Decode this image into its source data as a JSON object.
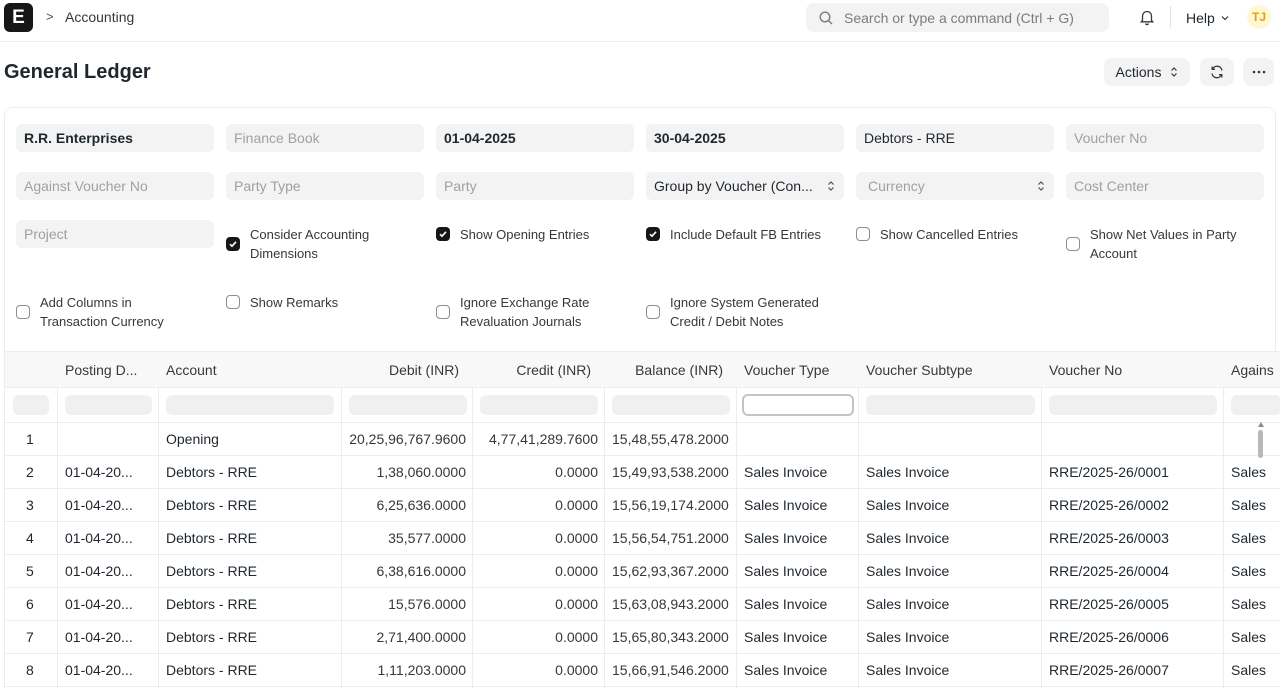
{
  "navbar": {
    "logo_letter": "E",
    "breadcrumb_sep": ">",
    "breadcrumb": "Accounting",
    "search_placeholder": "Search or type a command (Ctrl + G)",
    "help_label": "Help",
    "avatar_initials": "TJ"
  },
  "page": {
    "title": "General Ledger",
    "actions_label": "Actions"
  },
  "filters": {
    "company": "R.R. Enterprises",
    "finance_book_placeholder": "Finance Book",
    "from_date": "01-04-2025",
    "to_date": "30-04-2025",
    "account": "Debtors - RRE",
    "voucher_no_placeholder": "Voucher No",
    "against_voucher_no_placeholder": "Against Voucher No",
    "party_type_placeholder": "Party Type",
    "party_placeholder": "Party",
    "group_by": "Group by Voucher (Con...",
    "currency_placeholder": "Currency",
    "cost_center_placeholder": "Cost Center",
    "project_placeholder": "Project",
    "checkboxes": [
      {
        "label_1": "Consider Accounting",
        "label_2": "Dimensions",
        "checked": true
      },
      {
        "label_1": "Show Opening Entries",
        "label_2": "",
        "checked": true
      },
      {
        "label_1": "Include Default FB Entries",
        "label_2": "",
        "checked": true
      },
      {
        "label_1": "Show Cancelled Entries",
        "label_2": "",
        "checked": false
      },
      {
        "label_1": "Show Net Values in Party",
        "label_2": "Account",
        "checked": false
      },
      {
        "label_1": "Add Columns in",
        "label_2": "Transaction Currency",
        "checked": false
      },
      {
        "label_1": "Show Remarks",
        "label_2": "",
        "checked": false
      },
      {
        "label_1": "Ignore Exchange Rate",
        "label_2": "Revaluation Journals",
        "checked": false
      },
      {
        "label_1": "Ignore System Generated",
        "label_2": "Credit / Debit Notes",
        "checked": false
      }
    ]
  },
  "table": {
    "columns": [
      "Posting D...",
      "Account",
      "Debit (INR)",
      "Credit (INR)",
      "Balance (INR)",
      "Voucher Type",
      "Voucher Subtype",
      "Voucher No",
      "Agains"
    ],
    "rows": [
      {
        "idx": "1",
        "posting_date": "",
        "account": "Opening",
        "debit": "20,25,96,767.9600",
        "credit": "4,77,41,289.7600",
        "balance": "15,48,55,478.2000",
        "voucher_type": "",
        "voucher_subtype": "",
        "voucher_no": "",
        "against": ""
      },
      {
        "idx": "2",
        "posting_date": "01-04-20...",
        "account": "Debtors - RRE",
        "debit": "1,38,060.0000",
        "credit": "0.0000",
        "balance": "15,49,93,538.2000",
        "voucher_type": "Sales Invoice",
        "voucher_subtype": "Sales Invoice",
        "voucher_no": "RRE/2025-26/0001",
        "against": "Sales"
      },
      {
        "idx": "3",
        "posting_date": "01-04-20...",
        "account": "Debtors - RRE",
        "debit": "6,25,636.0000",
        "credit": "0.0000",
        "balance": "15,56,19,174.2000",
        "voucher_type": "Sales Invoice",
        "voucher_subtype": "Sales Invoice",
        "voucher_no": "RRE/2025-26/0002",
        "against": "Sales"
      },
      {
        "idx": "4",
        "posting_date": "01-04-20...",
        "account": "Debtors - RRE",
        "debit": "35,577.0000",
        "credit": "0.0000",
        "balance": "15,56,54,751.2000",
        "voucher_type": "Sales Invoice",
        "voucher_subtype": "Sales Invoice",
        "voucher_no": "RRE/2025-26/0003",
        "against": "Sales"
      },
      {
        "idx": "5",
        "posting_date": "01-04-20...",
        "account": "Debtors - RRE",
        "debit": "6,38,616.0000",
        "credit": "0.0000",
        "balance": "15,62,93,367.2000",
        "voucher_type": "Sales Invoice",
        "voucher_subtype": "Sales Invoice",
        "voucher_no": "RRE/2025-26/0004",
        "against": "Sales"
      },
      {
        "idx": "6",
        "posting_date": "01-04-20...",
        "account": "Debtors - RRE",
        "debit": "15,576.0000",
        "credit": "0.0000",
        "balance": "15,63,08,943.2000",
        "voucher_type": "Sales Invoice",
        "voucher_subtype": "Sales Invoice",
        "voucher_no": "RRE/2025-26/0005",
        "against": "Sales"
      },
      {
        "idx": "7",
        "posting_date": "01-04-20...",
        "account": "Debtors - RRE",
        "debit": "2,71,400.0000",
        "credit": "0.0000",
        "balance": "15,65,80,343.2000",
        "voucher_type": "Sales Invoice",
        "voucher_subtype": "Sales Invoice",
        "voucher_no": "RRE/2025-26/0006",
        "against": "Sales"
      },
      {
        "idx": "8",
        "posting_date": "01-04-20...",
        "account": "Debtors - RRE",
        "debit": "1,11,203.0000",
        "credit": "0.0000",
        "balance": "15,66,91,546.2000",
        "voucher_type": "Sales Invoice",
        "voucher_subtype": "Sales Invoice",
        "voucher_no": "RRE/2025-26/0007",
        "against": "Sales"
      }
    ]
  },
  "icons": {
    "search": "search-icon",
    "bell": "bell-icon",
    "refresh": "refresh-icon",
    "more": "more-icon",
    "chevron": "chevron-down-icon"
  },
  "colors": {
    "logo_bg": "#171717",
    "field_bg": "#f3f3f3",
    "avatar_bg": "#fff7d3",
    "avatar_fg": "#e3a00e"
  }
}
